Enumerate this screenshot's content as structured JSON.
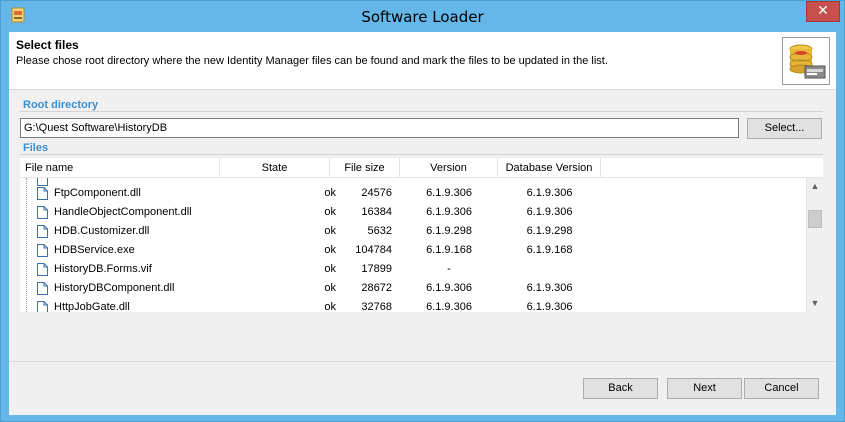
{
  "window": {
    "title": "Software Loader",
    "close_glyph": "✕"
  },
  "header": {
    "title": "Select files",
    "description": "Please chose root directory where the new Identity Manager files can be found and mark the files to be updated in the list."
  },
  "root_directory": {
    "label": "Root directory",
    "value": "G:\\Quest Software\\HistoryDB",
    "select_label": "Select..."
  },
  "files": {
    "label": "Files",
    "columns": [
      "File name",
      "State",
      "File size",
      "Version",
      "Database Version"
    ],
    "rows": [
      {
        "name": "FtpComponent.dll",
        "state": "ok",
        "size": "24576",
        "version": "6.1.9.306",
        "db_version": "6.1.9.306"
      },
      {
        "name": "HandleObjectComponent.dll",
        "state": "ok",
        "size": "16384",
        "version": "6.1.9.306",
        "db_version": "6.1.9.306"
      },
      {
        "name": "HDB.Customizer.dll",
        "state": "ok",
        "size": "5632",
        "version": "6.1.9.298",
        "db_version": "6.1.9.298"
      },
      {
        "name": "HDBService.exe",
        "state": "ok",
        "size": "104784",
        "version": "6.1.9.168",
        "db_version": "6.1.9.168"
      },
      {
        "name": "HistoryDB.Forms.vif",
        "state": "ok",
        "size": "17899",
        "version": "-",
        "db_version": ""
      },
      {
        "name": "HistoryDBComponent.dll",
        "state": "ok",
        "size": "28672",
        "version": "6.1.9.306",
        "db_version": "6.1.9.306"
      },
      {
        "name": "HttpJobGate.dll",
        "state": "ok",
        "size": "32768",
        "version": "6.1.9.306",
        "db_version": "6.1.9.306"
      }
    ]
  },
  "buttons": {
    "back": "Back",
    "next": "Next",
    "cancel": "Cancel"
  },
  "colors": {
    "titlebar": "#64b7e8",
    "section_label": "#3b8fd1",
    "close": "#c7504c"
  }
}
